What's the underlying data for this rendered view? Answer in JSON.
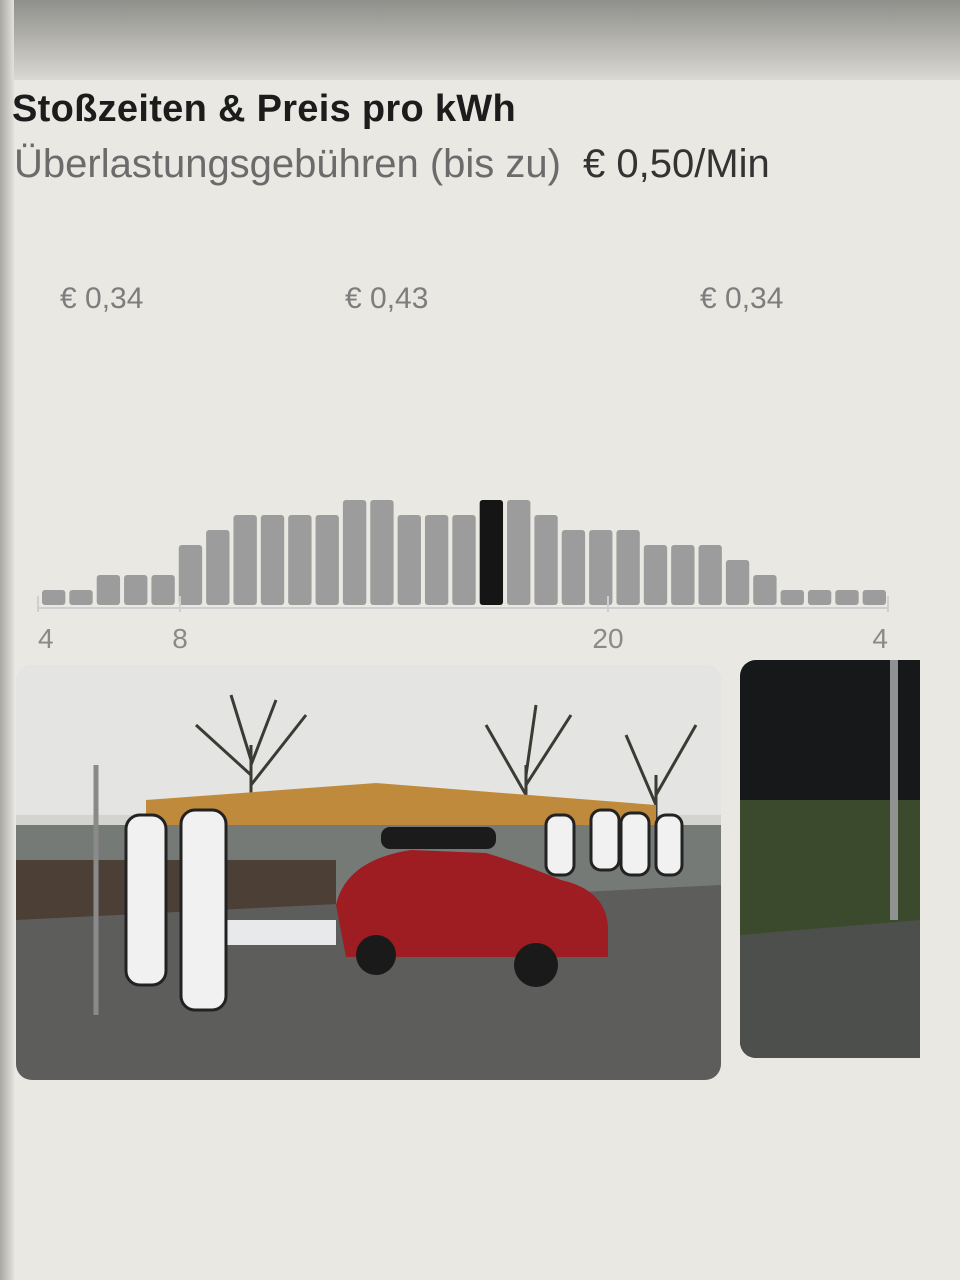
{
  "header": {
    "title": "Stoßzeiten & Preis pro kWh",
    "congestion_label": "Überlastungsgebühren (bis zu)",
    "congestion_fee": "€ 0,50/Min"
  },
  "price_periods": [
    {
      "label": "€ 0,34"
    },
    {
      "label": "€ 0,43"
    },
    {
      "label": "€ 0,34"
    }
  ],
  "chart_data": {
    "type": "bar",
    "x_ticks": [
      "4",
      "8",
      "20",
      "4"
    ],
    "values": [
      1,
      1,
      2,
      2,
      2,
      4,
      5,
      6,
      6,
      6,
      6,
      7,
      7,
      6,
      6,
      6,
      7,
      7,
      6,
      5,
      5,
      5,
      4,
      4,
      4,
      3,
      2,
      1,
      1,
      1,
      1
    ],
    "highlight_index": 16,
    "bar_color": "#9c9c9c",
    "highlight_color": "#151515",
    "ylim": [
      0,
      8
    ]
  },
  "photos": [
    {
      "name": "supercharger-photo"
    },
    {
      "name": "supercharger-photo-2"
    }
  ]
}
